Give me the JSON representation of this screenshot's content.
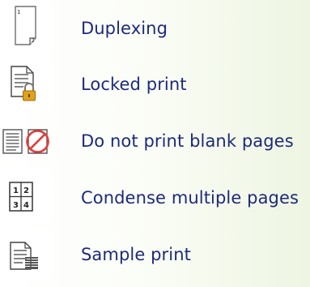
{
  "features": [
    {
      "label": "Duplexing",
      "icon": "duplex-page-icon"
    },
    {
      "label": "Locked print",
      "icon": "locked-document-icon"
    },
    {
      "label": "Do not print blank pages",
      "icon": "no-blank-pages-icon"
    },
    {
      "label": "Condense multiple pages",
      "icon": "four-up-pages-icon"
    },
    {
      "label": "Sample print",
      "icon": "sample-print-stack-icon"
    }
  ],
  "colors": {
    "label_text": "#1d2a7a",
    "prohibit_red": "#e23b3b",
    "lock_gold": "#e0a21a"
  }
}
